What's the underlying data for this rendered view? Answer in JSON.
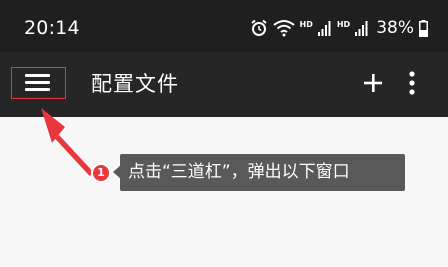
{
  "status_bar": {
    "time": "20:14",
    "network_label_1": "HD",
    "network_label_2": "HD",
    "battery_percent": "38%",
    "icons": [
      "alarm-icon",
      "wifi-icon",
      "signal-icon",
      "signal-icon",
      "battery-icon"
    ]
  },
  "toolbar": {
    "title": "配置文件",
    "menu_icon": "hamburger-menu-icon",
    "add_icon": "plus-icon",
    "more_icon": "more-vertical-icon"
  },
  "annotation": {
    "step_number": "1",
    "text": "点击“三道杠”，弹出以下窗口",
    "highlight_color": "#e03a3a",
    "arrow_color": "#e8383d"
  },
  "colors": {
    "status_bar_bg": "#1f1f1f",
    "toolbar_bg": "#262626",
    "content_bg": "#f7f7f7",
    "tooltip_bg": "#595959"
  }
}
